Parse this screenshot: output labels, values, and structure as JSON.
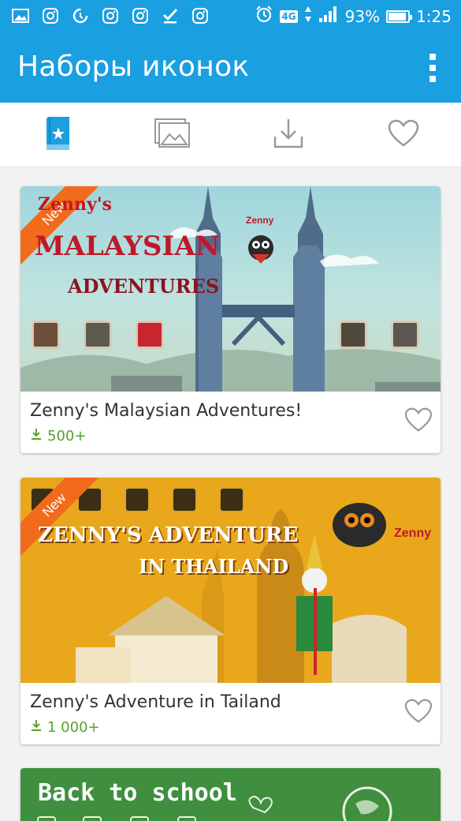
{
  "status_bar": {
    "network": "4G",
    "battery_percent": "93%",
    "battery_level": 0.93,
    "time": "1:25"
  },
  "app_bar": {
    "title": "Наборы иконок"
  },
  "tabs": [
    {
      "icon": "book-star-icon",
      "active": true
    },
    {
      "icon": "images-icon",
      "active": false
    },
    {
      "icon": "download-tray-icon",
      "active": false
    },
    {
      "icon": "heart-outline-icon",
      "active": false
    }
  ],
  "colors": {
    "primary": "#1a9fe0",
    "download_green": "#5aa12a",
    "ribbon_orange": "#f26a1b"
  },
  "cards": [
    {
      "name": "Zenny's Malaysian Adventures!",
      "downloads": "500+",
      "badge": "New",
      "banner_text": {
        "line1": "Zenny's",
        "line2": "Malaysian",
        "line3": "Adventures",
        "brand": "Zenny"
      }
    },
    {
      "name": "Zenny's Adventure in Tailand",
      "downloads": "1 000+",
      "badge": "New",
      "banner_text": {
        "line1": "Zenny's Adventure",
        "line2": "in Thailand",
        "brand": "Zenny"
      }
    },
    {
      "banner_text": {
        "line1": "Back to school"
      }
    }
  ]
}
